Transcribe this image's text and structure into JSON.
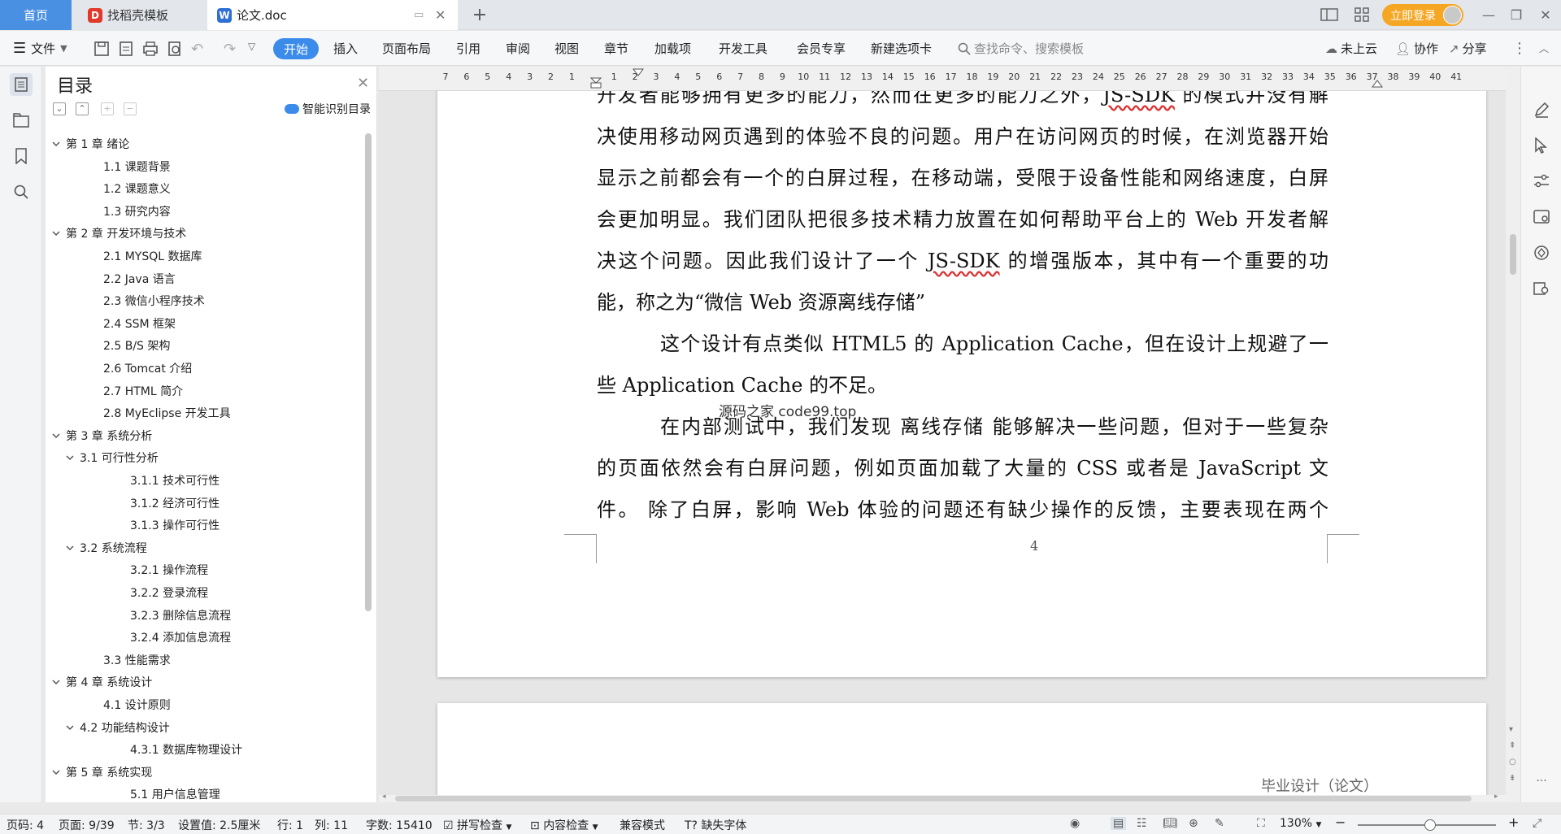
{
  "tabs": {
    "home": "首页",
    "template": "找稻壳模板",
    "doc": "论文.doc"
  },
  "titlebar": {
    "login": "立即登录"
  },
  "ribbon": {
    "file": "文件",
    "start": "开始",
    "insert": "插入",
    "layout": "页面布局",
    "reference": "引用",
    "review": "审阅",
    "view": "视图",
    "chapter": "章节",
    "addons": "加载项",
    "devtools": "开发工具",
    "vip": "会员专享",
    "newtab": "新建选项卡",
    "search_placeholder": "查找命令、搜索模板",
    "cloud": "未上云",
    "collab": "协作",
    "share": "分享"
  },
  "toc": {
    "title": "目录",
    "smart": "智能识别目录",
    "items": [
      "第 1 章 绪论",
      "1.1 课题背景",
      "1.2 课题意义",
      "1.3 研究内容",
      "第 2 章 开发环境与技术",
      "2.1 MYSQL 数据库",
      "2.2 Java 语言",
      "2.3 微信小程序技术",
      "2.4 SSM 框架",
      "2.5 B/S 架构",
      "2.6 Tomcat 介绍",
      "2.7 HTML 简介",
      "2.8 MyEclipse 开发工具",
      "第 3 章 系统分析",
      "3.1 可行性分析",
      "3.1.1 技术可行性",
      "3.1.2 经济可行性",
      "3.1.3 操作可行性",
      "3.2 系统流程",
      "3.2.1 操作流程",
      "3.2.2 登录流程",
      "3.2.3 删除信息流程",
      "3.2.4 添加信息流程",
      "3.3 性能需求",
      "第 4 章 系统设计",
      "4.1 设计原则",
      "4.2 功能结构设计",
      "4.3.1 数据库物理设计",
      "第 5 章 系统实现",
      "5.1 用户信息管理"
    ]
  },
  "ruler": [
    "7",
    "6",
    "5",
    "4",
    "3",
    "2",
    "1",
    "",
    "1",
    "2",
    "3",
    "4",
    "5",
    "6",
    "7",
    "8",
    "9",
    "10",
    "11",
    "12",
    "13",
    "14",
    "15",
    "16",
    "17",
    "18",
    "19",
    "20",
    "21",
    "22",
    "23",
    "24",
    "25",
    "26",
    "27",
    "28",
    "29",
    "30",
    "31",
    "32",
    "33",
    "34",
    "35",
    "36",
    "37",
    "38",
    "39",
    "40",
    "41"
  ],
  "document": {
    "p1": [
      "开发者能够拥有更多的能力，然而在更多的能力之外，JS-SDK 的模式并没有解",
      "决使用移动网页遇到的体验不良的问题。用户在访问网页的时候，在浏览器开始",
      "显示之前都会有一个的白屏过程，在移动端，受限于设备性能和网络速度，白屏",
      "会更加明显。我们团队把很多技术精力放置在如何帮助平台上的 Web 开发者解",
      "决这个问题。因此我们设计了一个 JS-SDK 的增强版本，其中有一个重要的功",
      "能，称之为“微信 Web 资源离线存储”"
    ],
    "p2": [
      "这个设计有点类似 HTML5 的 Application Cache，但在设计上规避了一",
      "些 Application Cache 的不足。"
    ],
    "p3": [
      "在内部测试中，我们发现 离线存储 能够解决一些问题，但对于一些复杂",
      "的页面依然会有白屏问题，例如页面加载了大量的 CSS 或者是 JavaScript 文",
      "件。 除了白屏，影响 Web 体验的问题还有缺少操作的反馈，主要表现在两个"
    ],
    "watermark": "源码之家 code99.top",
    "page_number": "4",
    "page2_header": "毕业设计（论文）"
  },
  "status": {
    "page": "页码: 4",
    "pages": "页面: 9/39",
    "section": "节: 3/3",
    "setting": "设置值: 2.5厘米",
    "row": "行: 1",
    "col": "列: 11",
    "words": "字数: 15410",
    "spell": "拼写检查",
    "content": "内容检查",
    "compat": "兼容模式",
    "missing_font": "缺失字体",
    "zoom": "130%"
  }
}
